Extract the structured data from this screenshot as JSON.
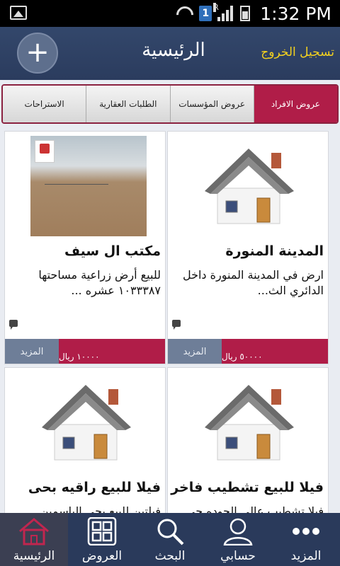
{
  "status": {
    "time": "1:32 PM",
    "sim": "1",
    "roaming": "R"
  },
  "header": {
    "add_label": "+",
    "title": "الرئيسية",
    "logout": "تسجيل الخروج"
  },
  "tabs": [
    {
      "label": "عروض الافراد",
      "active": true
    },
    {
      "label": "عروض المؤسسات",
      "active": false
    },
    {
      "label": "الطلبات العقارية",
      "active": false
    },
    {
      "label": "الاستراحات",
      "active": false
    }
  ],
  "cards": [
    {
      "title": "المدينة المنورة",
      "desc": "ارض  في المدينة المنورة داخل الدائري الث...",
      "price": "٥٠٠٠٠ ريال",
      "more": "المزيد",
      "image": "house-icon"
    },
    {
      "title": "مكتب ال سيف",
      "desc": "للبيع أرض زراعية مساحتها ١٠٣٣٣٨٧ عشره ...",
      "price": "١٠٠٠٠ ريال",
      "more": "المزيد",
      "image": "land-photo"
    },
    {
      "title": "فيلا للبيع تشطيب فاخر",
      "desc": "فيلا تشطيب عالي الجوده حي",
      "image": "house-icon"
    },
    {
      "title": "فيلا للبيع راقيه بحى",
      "desc": "فيلتين للبيع بحي الياسمين",
      "image": "house-icon"
    }
  ],
  "nav": [
    {
      "label": "المزيد",
      "icon": "more-dots-icon",
      "active": false
    },
    {
      "label": "حسابي",
      "icon": "user-icon",
      "active": false
    },
    {
      "label": "البحث",
      "icon": "search-icon",
      "active": false
    },
    {
      "label": "العروض",
      "icon": "grid-icon",
      "active": false
    },
    {
      "label": "الرئيسية",
      "icon": "home-icon",
      "active": true
    }
  ]
}
